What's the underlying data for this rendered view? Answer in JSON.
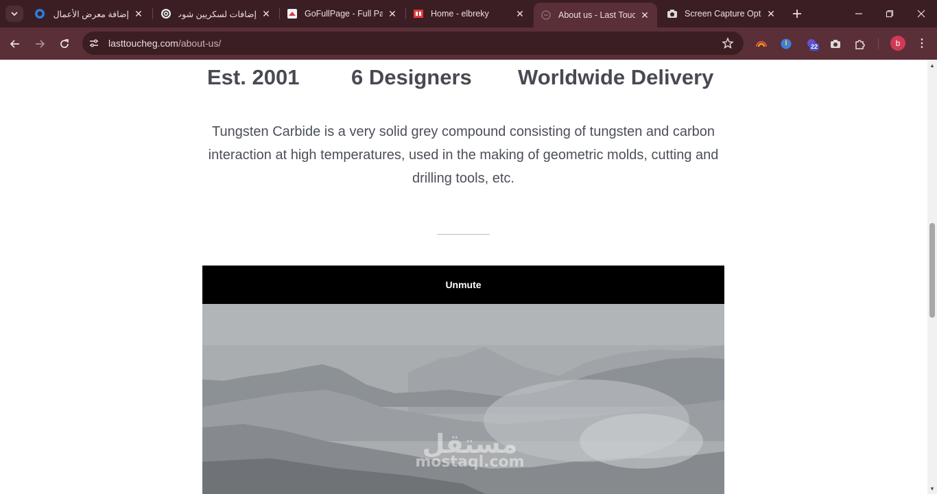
{
  "browser": {
    "tabs": [
      {
        "title": "إضافة معرض الأعمال",
        "active": false,
        "icon": "circle-logo-icon",
        "rtl": true
      },
      {
        "title": "إضافات لسكريين شوت",
        "active": false,
        "icon": "openai-icon",
        "rtl": true
      },
      {
        "title": "GoFullPage - Full Page",
        "active": false,
        "icon": "gofullpage-icon",
        "rtl": false
      },
      {
        "title": "Home - elbreky",
        "active": false,
        "icon": "elbreky-icon",
        "rtl": false
      },
      {
        "title": "About us - Last Touch",
        "active": true,
        "icon": "lasttouch-icon",
        "rtl": false
      },
      {
        "title": "Screen Capture Options",
        "active": false,
        "icon": "camera-icon",
        "rtl": false
      }
    ],
    "url": {
      "domain": "lasttoucheg.com",
      "path": "/about-us/"
    },
    "extension_badge": "22",
    "profile_initial": "b"
  },
  "page": {
    "stats": [
      "Est. 2001",
      "6 Designers",
      "Worldwide Delivery"
    ],
    "description": "Tungsten Carbide is a very solid grey compound consisting of tungsten and carbon interaction at high temperatures, used in the making of geometric molds, cutting and drilling tools, etc.",
    "video": {
      "unmute_label": "Unmute"
    },
    "watermark": {
      "arabic": "مستقل",
      "latin": "mostaql.com"
    }
  },
  "colors": {
    "chrome_dark": "#3b1e24",
    "chrome_toolbar": "#5a2f37",
    "heading": "#474a52",
    "body_text": "#4b4f58"
  }
}
